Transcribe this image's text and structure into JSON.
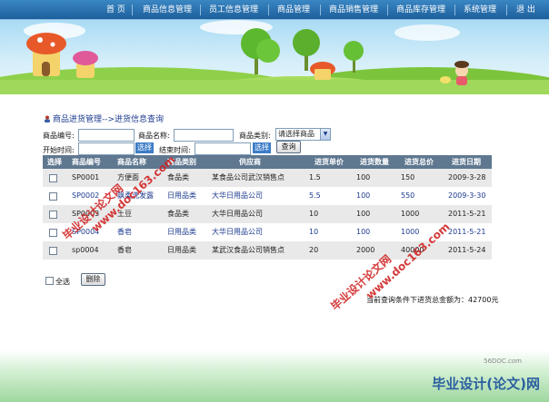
{
  "nav": [
    "首 页",
    "商品信息管理",
    "员工信息管理",
    "商品管理",
    "商品销售管理",
    "商品库存管理",
    "系统管理",
    "退 出"
  ],
  "breadcrumb": "商品进货管理-->进货信息查询",
  "filters": {
    "code_label": "商品编号:",
    "name_label": "商品名称:",
    "category_label": "商品类别:",
    "category_value": "请选择商品",
    "start_label": "开始时间:",
    "end_label": "结束时间:",
    "pick_label": "选择",
    "query_label": "查询"
  },
  "table": {
    "headers": [
      "选择",
      "商品编号",
      "商品名称",
      "商品类别",
      "供应商",
      "进货单价",
      "进货数量",
      "进货总价",
      "进货日期"
    ],
    "rows": [
      [
        "",
        "SP0001",
        "方便面",
        "食品类",
        "某食品公司武汉销售点",
        "1.5",
        "100",
        "150",
        "2009-3-28"
      ],
      [
        "",
        "SP0002",
        "飘柔洗发露",
        "日用品类",
        "大华日用品公司",
        "5.5",
        "100",
        "550",
        "2009-3-30"
      ],
      [
        "",
        "SP0003",
        "土豆",
        "食品类",
        "大华日用品公司",
        "10",
        "100",
        "1000",
        "2011-5-21"
      ],
      [
        "",
        "SP0004",
        "香皂",
        "日用品类",
        "大华日用品公司",
        "10",
        "100",
        "1000",
        "2011-5-21"
      ],
      [
        "",
        "sp0004",
        "香皂",
        "日用品类",
        "某武汉食品公司销售点",
        "20",
        "2000",
        "40000",
        "2011-5-24"
      ]
    ]
  },
  "select_all_label": "全选",
  "delete_label": "删除",
  "total_text": "当前查询条件下进货总金额为：42700元",
  "watermarks": [
    "毕业设计论文网",
    "www.doc163.com"
  ],
  "footer_logo": "毕业设计(论文)网",
  "footer_site": "56DOC.com",
  "colors": {
    "nav": "#1d5f9b",
    "header_row": "#5f7890",
    "link": "#1d3b8f",
    "watermark": "#d02020"
  }
}
